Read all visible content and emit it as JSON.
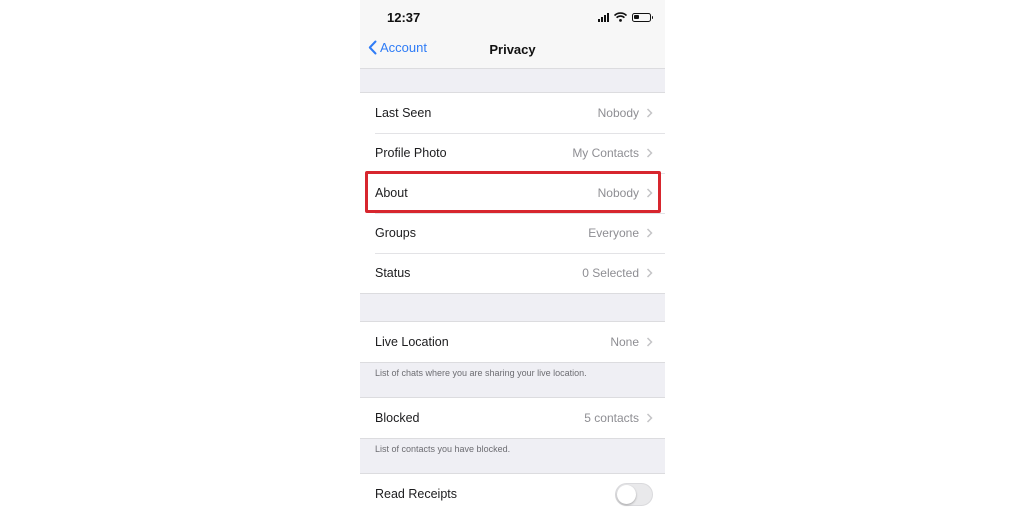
{
  "status_bar": {
    "time": "12:37"
  },
  "nav": {
    "back_label": "Account",
    "title": "Privacy"
  },
  "group1": [
    {
      "label": "Last Seen",
      "value": "Nobody"
    },
    {
      "label": "Profile Photo",
      "value": "My Contacts"
    },
    {
      "label": "About",
      "value": "Nobody"
    },
    {
      "label": "Groups",
      "value": "Everyone"
    },
    {
      "label": "Status",
      "value": "0 Selected"
    }
  ],
  "live_location": {
    "label": "Live Location",
    "value": "None",
    "note": "List of chats where you are sharing your live location."
  },
  "blocked": {
    "label": "Blocked",
    "value": "5 contacts",
    "note": "List of contacts you have blocked."
  },
  "read_receipts": {
    "label": "Read Receipts",
    "enabled": false
  },
  "colors": {
    "accent": "#2f7cf6",
    "highlight_box": "#d7262e",
    "value_text": "#8e8e93"
  }
}
